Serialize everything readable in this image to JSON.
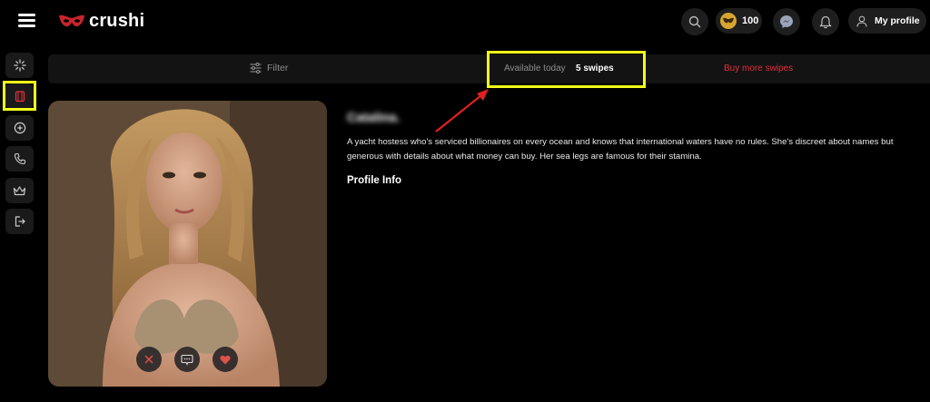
{
  "header": {
    "logo_text": "crushi",
    "coins": "100",
    "profile_label": "My profile",
    "brand_color": "#c8242c"
  },
  "sidebar": {
    "items": [
      {
        "icon": "sparkle-icon"
      },
      {
        "icon": "cards-icon",
        "active": true
      },
      {
        "icon": "plus-circle-icon"
      },
      {
        "icon": "phone-icon"
      },
      {
        "icon": "crown-icon"
      },
      {
        "icon": "logout-icon"
      }
    ]
  },
  "filterbar": {
    "filter_label": "Filter",
    "available_label": "Available today",
    "swipes_label": "5 swipes",
    "buy_label": "Buy more swipes"
  },
  "profile": {
    "name": "Catalina.",
    "bio": "A yacht hostess who's serviced billionaires on every ocean and knows that international waters have no rules. She's discreet about names but generous with details about what money can buy. Her sea legs are famous for their stamina.",
    "info_heading": "Profile Info"
  },
  "card_actions": [
    "close-icon",
    "chat-icon",
    "heart-icon"
  ],
  "colors": {
    "accent_red": "#e0303c",
    "highlight_yellow": "#f2ff1a",
    "background": "#000000"
  }
}
